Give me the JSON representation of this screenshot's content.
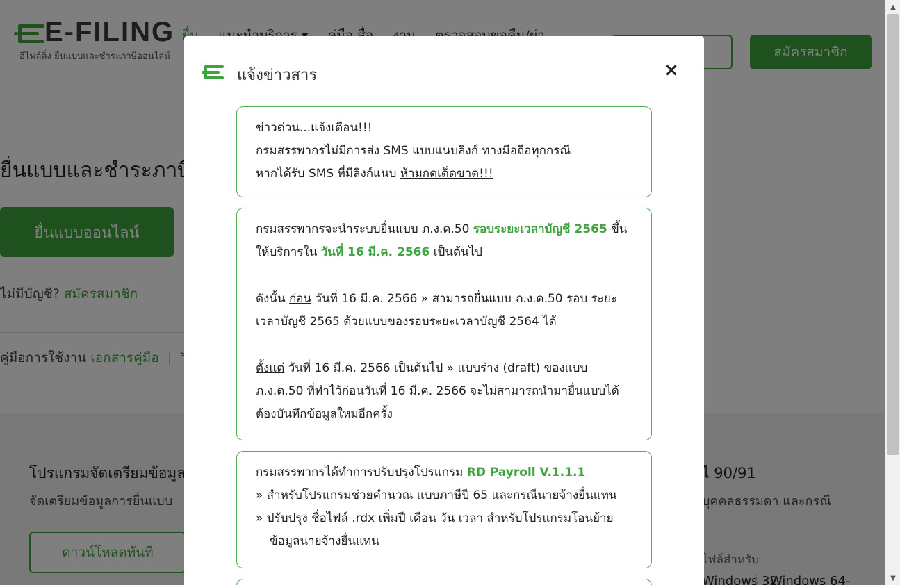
{
  "header": {
    "logo_text": "E-FILING",
    "logo_subtitle": "อีไฟล์ลิ่ง ยื่นแบบและชำระภาษีออนไลน์",
    "nav": [
      {
        "label": "ยื่น"
      },
      {
        "label": "แนะนำบริการ ▾"
      },
      {
        "label": "คู่มือ สื่อ"
      },
      {
        "label": "งาน"
      },
      {
        "label": "ตรวจสอบขอคืน/ผ่า"
      }
    ],
    "signup_label": "สมัครสมาชิก"
  },
  "hero": {
    "title": "ยื่นแบบและชำระภาษีผ",
    "file_online_label": "ยื่นแบบออนไลน์",
    "no_account_text": "ไม่มีบัญชี?",
    "no_account_link": "สมัครสมาชิก",
    "manual_label": "คู่มือการใช้งาน",
    "manual_doc_link": "เอกสารคู่มือ",
    "manual_sep": "|",
    "manual_next": "วิ"
  },
  "program": {
    "title": "โปรแกรมจัดเตรียมข้อมูล",
    "subtitle": "จัดเตรียมข้อมูลการยื่นแบบ",
    "download_label": "ดาวน์โหลดทันที",
    "right_title": "ไ 90/91",
    "right_subtitle": "บุคคลธรรมดา และกรณี",
    "right_note": "ไฟล์สำหรับ",
    "win32_label": "Windows 32-",
    "win64_label": "Windows 64-"
  },
  "modal": {
    "title": "แจ้งข่าวสาร",
    "close_label": "×",
    "card1": {
      "heading": "ข่าวด่วน...แจ้งเตือน!!!",
      "line2": "กรมสรรพากรไม่มีการส่ง SMS แบบแนบลิงก์ ทางมือถือทุกกรณี",
      "line3_prefix": "หากได้รับ SMS ที่มีลิงก์แนบ ",
      "line3_underlined": "ห้ามกดเด็ดขาด!!!"
    },
    "card2": {
      "p1_a": "กรมสรรพากรจะนำระบบยื่นแบบ ภ.ง.ด.50 ",
      "p1_green": "รอบระยะเวลาบัญชี 2565",
      "p1_b": " ขึ้นให้บริการใน ",
      "p1_green2": "วันที่ 16 มี.ค. 2566",
      "p1_c": " เป็นต้นไป",
      "p2_underlined": "ก่อน",
      "p2_prefix": "ดังนั้น ",
      "p2_rest": " วันที่ 16 มี.ค. 2566 » สามารถยื่นแบบ ภ.ง.ด.50 รอบ ระยะเวลาบัญชี 2565 ด้วยแบบของรอบระยะเวลาบัญชี 2564 ได้",
      "p3_underlined": "ตั้งแต่",
      "p3_rest": " วันที่ 16 มี.ค. 2566 เป็นต้นไป » แบบร่าง (draft) ของแบบ ภ.ง.ด.50 ที่ทำไว้ก่อนวันที่ 16 มี.ค. 2566 จะไม่สามารถนำมายื่นแบบได้ ต้องบันทึกข้อมูลใหม่อีกครั้ง"
    },
    "card3": {
      "heading_a": "กรมสรรพากรได้ทำการปรับปรุงโปรแกรม ",
      "heading_green": "RD Payroll V.1.1.1",
      "bullet1": "» สำหรับโปรแกรมช่วยคำนวณ แบบภาษีปี 65 และกรณีนายจ้างยื่นแทน",
      "bullet2": "» ปรับปรุง ชื่อไฟล์ .rdx เพิ่มปี เดือน วัน เวลา สำหรับโปรแกรมโอนย้ายข้อมูลนายจ้างยื่นแทน"
    }
  },
  "scrollbar": {
    "up_icon": "▲",
    "down_icon": "▼"
  },
  "colors": {
    "brand_green": "#3fa33f",
    "overlay": "rgba(0,0,0,0.5)"
  }
}
